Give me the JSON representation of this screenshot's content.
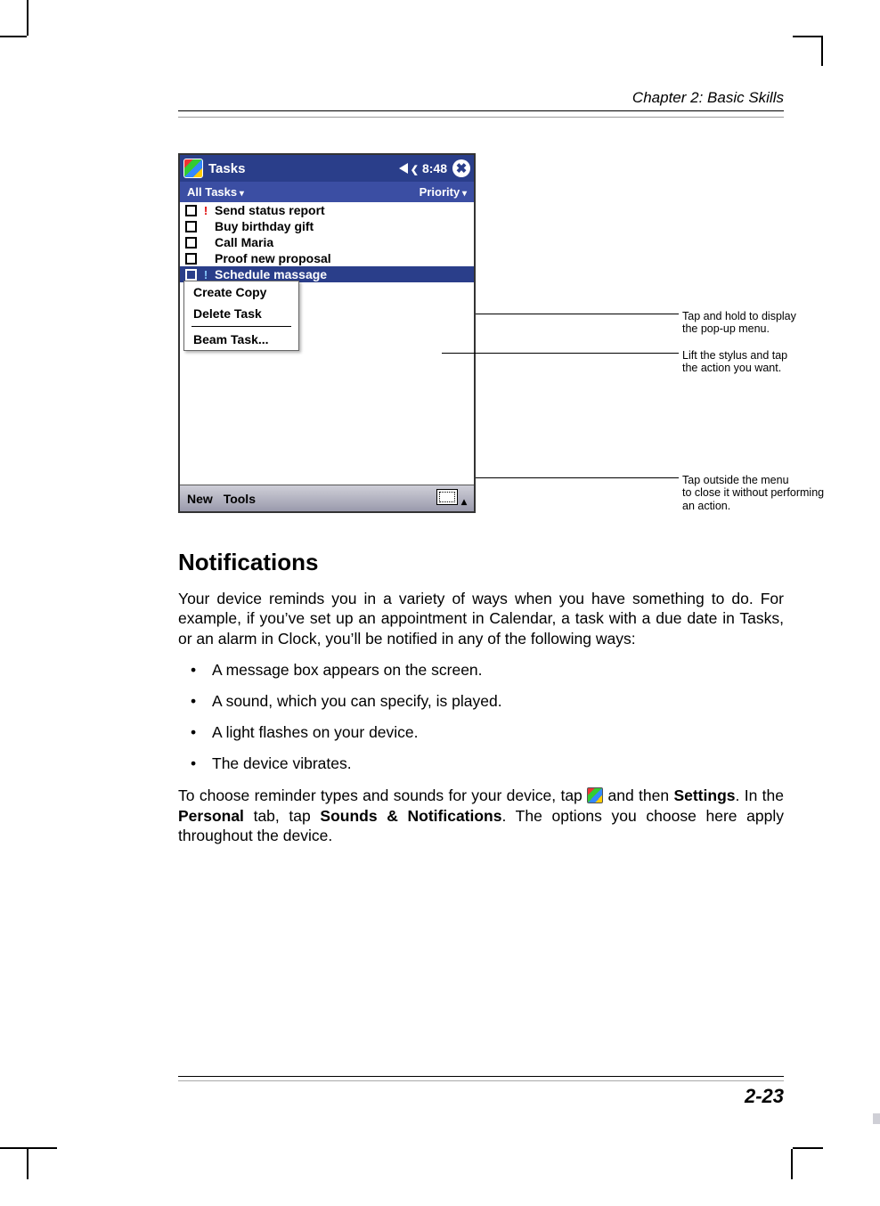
{
  "header": {
    "chapter": "Chapter 2: Basic Skills"
  },
  "device": {
    "titlebar": {
      "app": "Tasks",
      "time": "8:48"
    },
    "filterbar": {
      "left": "All Tasks",
      "right": "Priority"
    },
    "tasks": [
      {
        "priority": "!",
        "name": "Send status report",
        "selected": false
      },
      {
        "priority": "",
        "name": "Buy birthday gift",
        "selected": false
      },
      {
        "priority": "",
        "name": "Call Maria",
        "selected": false
      },
      {
        "priority": "",
        "name": "Proof new proposal",
        "selected": false
      },
      {
        "priority": "!",
        "name": "Schedule massage",
        "selected": true
      }
    ],
    "context_menu": {
      "items": [
        "Create Copy",
        "Delete Task",
        "Beam Task..."
      ]
    },
    "bottombar": {
      "left1": "New",
      "left2": "Tools"
    }
  },
  "callouts": {
    "c1a": "Tap and hold to display",
    "c1b": "the pop-up menu.",
    "c2a": "Lift the stylus and tap",
    "c2b": "the action you want.",
    "c3a": "Tap outside the menu",
    "c3b": "to close it without performing",
    "c3c": "an action."
  },
  "section": {
    "title": "Notifications",
    "para1": "Your device reminds you in a variety of ways when you have something to do. For example, if you’ve set up an appointment in Calendar, a task with a due date in Tasks, or an alarm in Clock, you’ll be notified in any of the following ways:",
    "bullets": [
      "A message box appears on the screen.",
      "A sound, which you can specify, is played.",
      "A light flashes on your device.",
      "The device vibrates."
    ],
    "para2a": "To choose reminder types and sounds for your device, tap ",
    "para2b": " and then ",
    "para2_bold1": "Settings",
    "para2c": ". In the ",
    "para2_bold2": "Personal",
    "para2d": " tab, tap ",
    "para2_bold3": "Sounds & Notifications",
    "para2e": ". The options you choose here apply throughout the device."
  },
  "footer": {
    "page": "2-23"
  }
}
